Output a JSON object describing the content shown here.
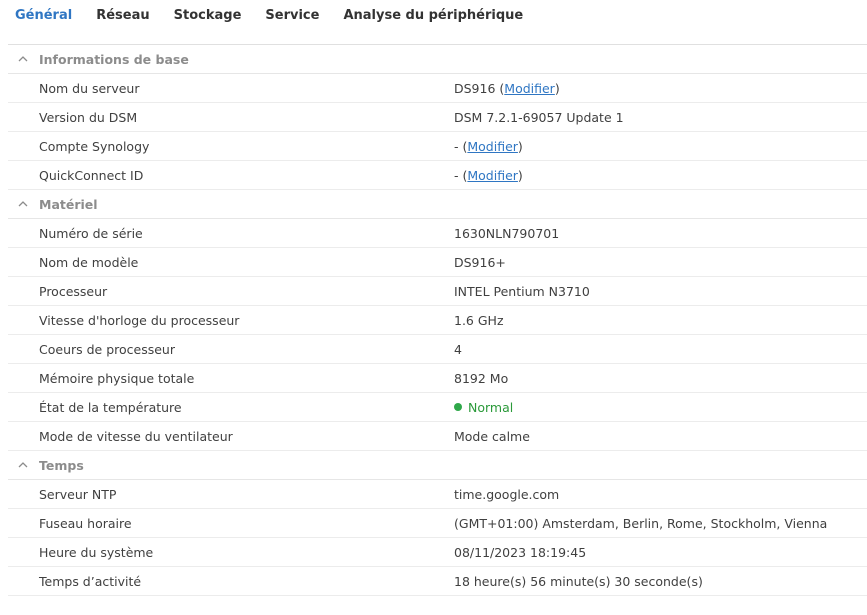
{
  "tabs": [
    {
      "label": "Général",
      "active": true
    },
    {
      "label": "Réseau",
      "active": false
    },
    {
      "label": "Stockage",
      "active": false
    },
    {
      "label": "Service",
      "active": false
    },
    {
      "label": "Analyse du périphérique",
      "active": false
    }
  ],
  "colors": {
    "accent": "#2f76c3",
    "status_ok": "#2fa84a"
  },
  "icons": {
    "section_toggle": "chevron-up-icon",
    "status": "status-dot-icon"
  },
  "sections": {
    "basic": {
      "title": "Informations de base",
      "rows": [
        {
          "label": "Nom du serveur",
          "value": "DS916",
          "link": "Modifier"
        },
        {
          "label": "Version du DSM",
          "value": "DSM 7.2.1-69057 Update 1"
        },
        {
          "label": "Compte Synology",
          "value": "-",
          "link": "Modifier"
        },
        {
          "label": "QuickConnect ID",
          "value": "-",
          "link": "Modifier"
        }
      ]
    },
    "hardware": {
      "title": "Matériel",
      "rows": [
        {
          "label": "Numéro de série",
          "value": "1630NLN790701"
        },
        {
          "label": "Nom de modèle",
          "value": "DS916+"
        },
        {
          "label": "Processeur",
          "value": "INTEL Pentium N3710"
        },
        {
          "label": "Vitesse d'horloge du processeur",
          "value": "1.6 GHz"
        },
        {
          "label": "Coeurs de processeur",
          "value": "4"
        },
        {
          "label": "Mémoire physique totale",
          "value": "8192 Mo"
        },
        {
          "label": "État de la température",
          "value": "Normal"
        },
        {
          "label": "Mode de vitesse du ventilateur",
          "value": "Mode calme"
        }
      ]
    },
    "time": {
      "title": "Temps",
      "rows": [
        {
          "label": "Serveur NTP",
          "value": "time.google.com"
        },
        {
          "label": "Fuseau horaire",
          "value": "(GMT+01:00) Amsterdam, Berlin, Rome, Stockholm, Vienna"
        },
        {
          "label": "Heure du système",
          "value": "08/11/2023 18:19:45"
        },
        {
          "label": "Temps d’activité",
          "value": "18 heure(s) 56 minute(s) 30 seconde(s)"
        }
      ]
    }
  }
}
